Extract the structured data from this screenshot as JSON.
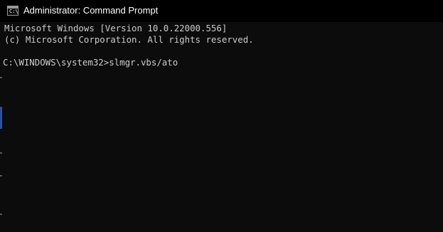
{
  "window": {
    "title": "Administrator: Command Prompt",
    "icon": "command-prompt-icon",
    "icon_glyph": "C:\\"
  },
  "console": {
    "lines": [
      "Microsoft Windows [Version 10.0.22000.556]",
      "(c) Microsoft Corporation. All rights reserved.",
      "C:\\WINDOWS\\system32>slmgr.vbs/ato"
    ]
  },
  "colors": {
    "background": "#0c0c0c",
    "text": "#cccccc",
    "titlebar": "#000000",
    "title_text": "#ffffff"
  }
}
